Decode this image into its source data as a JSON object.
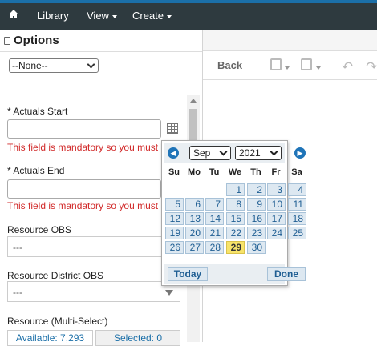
{
  "nav": {
    "home_icon": "home-icon",
    "library": "Library",
    "view": "View",
    "create": "Create"
  },
  "options": {
    "title": "Options",
    "filter_value": "--None--"
  },
  "form": {
    "actuals_start_label": "* Actuals Start",
    "actuals_start_error": "This field is mandatory so you must",
    "actuals_end_label": "* Actuals End",
    "actuals_end_error": "This field is mandatory so you must",
    "resource_obs_label": "Resource OBS",
    "resource_obs_value": "---",
    "resource_district_obs_label": "Resource District OBS",
    "resource_district_obs_value": "---",
    "resource_multi_label": "Resource (Multi-Select)",
    "available_tab": "Available: 7,293",
    "selected_tab": "Selected: 0"
  },
  "toolbar": {
    "back_label": "Back"
  },
  "calendar": {
    "month": "Sep",
    "year": "2021",
    "weekdays": [
      "Su",
      "Mo",
      "Tu",
      "We",
      "Th",
      "Fr",
      "Sa"
    ],
    "first_weekday_index": 3,
    "days_in_month": 30,
    "selected_day": 29,
    "today_label": "Today",
    "done_label": "Done",
    "colors": {
      "accent": "#1f74b8",
      "highlight": "#f7e36a"
    }
  }
}
